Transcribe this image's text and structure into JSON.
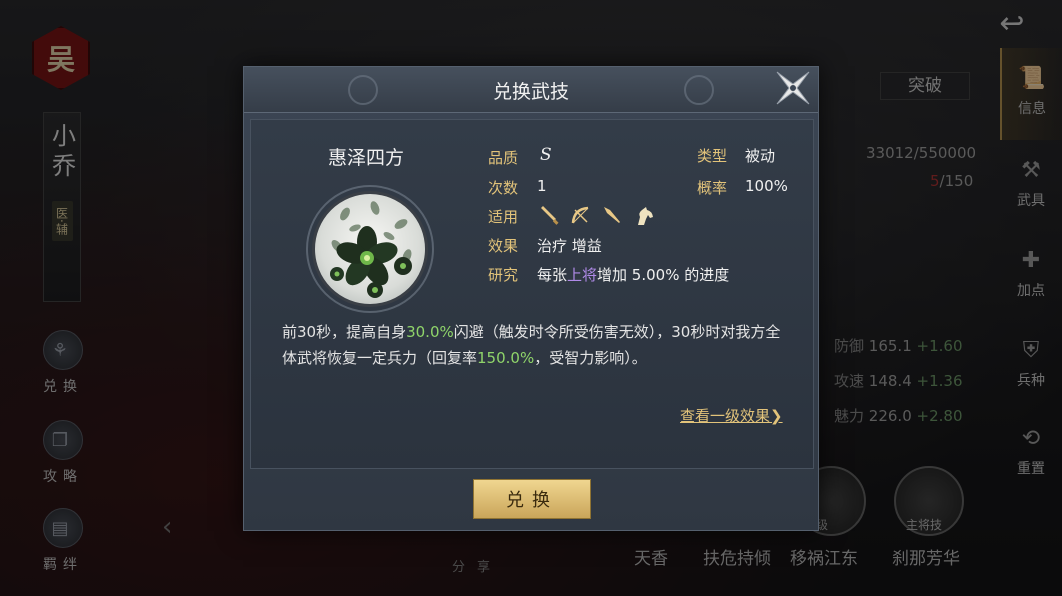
{
  "background": {
    "hero": {
      "clan": "吴",
      "name": "小乔",
      "role_tag": "医·辅"
    },
    "left_buttons": [
      {
        "label": "兑换",
        "icon": "exchange-icon"
      },
      {
        "label": "攻略",
        "icon": "strategy-icon"
      },
      {
        "label": "羁绊",
        "icon": "bond-icon"
      }
    ],
    "right_tabs": [
      {
        "label": "信息",
        "icon": "scroll-icon",
        "active": true
      },
      {
        "label": "武具",
        "icon": "armory-icon"
      },
      {
        "label": "加点",
        "icon": "points-icon"
      },
      {
        "label": "兵种",
        "icon": "troop-icon"
      },
      {
        "label": "重置",
        "icon": "reset-icon"
      }
    ],
    "breakthrough": "突破",
    "exp": "33012/550000",
    "level": {
      "current": "5",
      "max": "/150"
    },
    "stats": [
      {
        "name": "防御",
        "value": "165.1",
        "plus": "+1.60"
      },
      {
        "name": "攻速",
        "value": "148.4",
        "plus": "+1.36"
      },
      {
        "name": "魅力",
        "value": "226.0",
        "plus": "+2.80"
      }
    ],
    "skills": [
      "天香",
      "扶危持倾",
      "移祸江东",
      "刹那芳华"
    ],
    "skill_badges": [
      "级",
      "主将技"
    ],
    "share": "分享"
  },
  "modal": {
    "title": "兑换武技",
    "skill_name": "惠泽四方",
    "rows": {
      "quality_label": "品质",
      "quality_value": "S",
      "type_label": "类型",
      "type_value": "被动",
      "count_label": "次数",
      "count_value": "1",
      "rate_label": "概率",
      "rate_value": "100%",
      "apply_label": "适用",
      "effect_label": "效果",
      "effect_value": "治疗 增益",
      "research_label": "研究",
      "research_pre": "每张",
      "research_hl": "上将",
      "research_post": "增加 5.00% 的进度"
    },
    "weapons": [
      "sword-icon",
      "bow-icon",
      "spear-icon",
      "horse-icon"
    ],
    "description": {
      "p1": "前30秒，提高自身",
      "v1": "30.0%",
      "p2": "闪避（触发时令所受伤害无效），30秒时对我方全体武将恢复一定兵力（回复率",
      "v2": "150.0%",
      "p3": "，受智力影响）。"
    },
    "view_link": "查看一级效果❯",
    "exchange_button": "兑换"
  },
  "colors": {
    "gold": "#e2c37a",
    "green": "#8fd46a",
    "purple": "#b08ae8",
    "button": "#e9cd85"
  }
}
